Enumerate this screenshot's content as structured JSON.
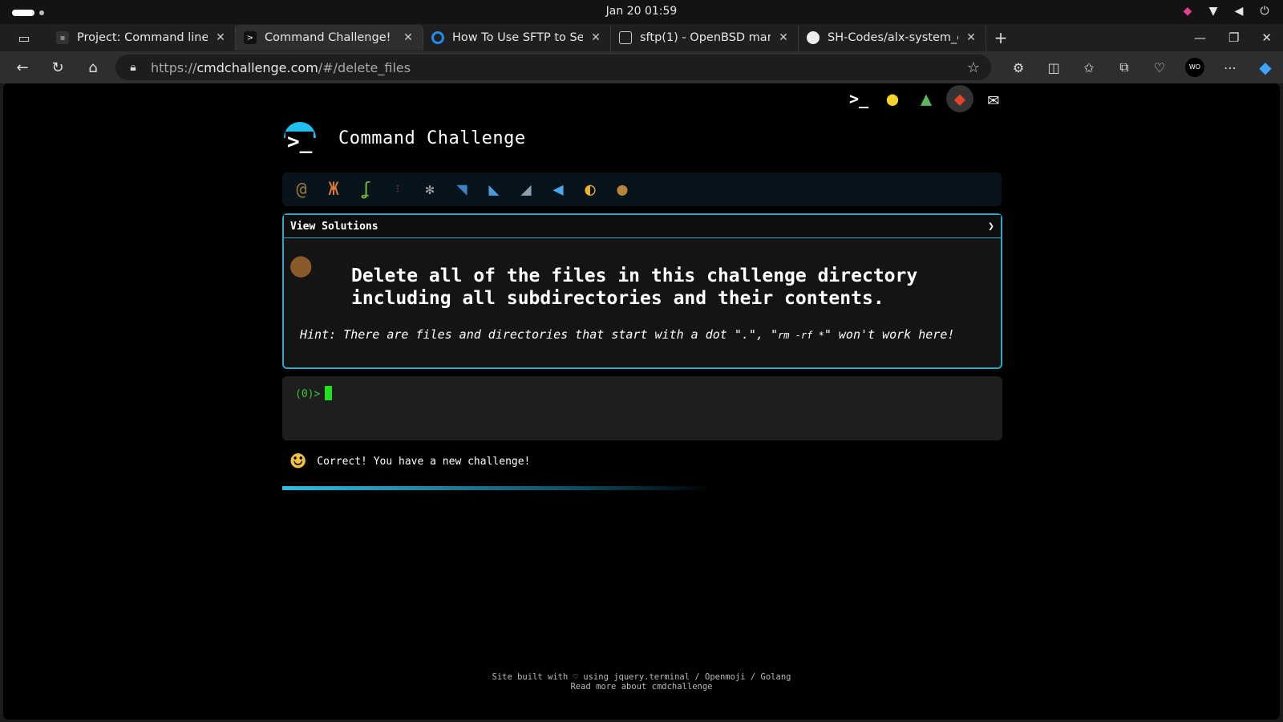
{
  "os": {
    "clock": "Jan 20  01:59"
  },
  "browser": {
    "tabs": [
      {
        "label": "Project: Command line fo",
        "active": false
      },
      {
        "label": "Command Challenge!",
        "active": true
      },
      {
        "label": "How To Use SFTP to Secur",
        "active": false
      },
      {
        "label": "sftp(1) - OpenBSD manua",
        "active": false
      },
      {
        "label": "SH-Codes/alx-system_eng",
        "active": false
      }
    ],
    "url": {
      "scheme": "https://",
      "host": "cmdchallenge.com",
      "path": "/#/delete_files"
    },
    "profile_badge": "WO"
  },
  "site": {
    "title": "Command Challenge",
    "level_icons": [
      "snail",
      "butterfly",
      "caterpillar",
      "ant",
      "spider-web",
      "whale",
      "dolphin",
      "shark",
      "fish",
      "tropical-fish",
      "blowfish"
    ],
    "solutions_label": "View Solutions",
    "solutions_chevron": "❯",
    "challenge_text": "Delete all of the files in this challenge directory including all subdirectories and their contents.",
    "hint_prefix": "Hint: There are files and directories that start with a dot \".\", \"",
    "hint_cmd": "rm -rf *",
    "hint_suffix": "\" won't work here!",
    "terminal_prompt": "(0)>",
    "feedback": "Correct! You have a new challenge!",
    "footer_line1": "Site built with ♡ using jquery.terminal / Openmoji / Golang",
    "footer_line2": "Read more about cmdchallenge"
  },
  "colors": {
    "accent": "#2fa6c6",
    "prompt": "#37c837",
    "cursor": "#22e022"
  }
}
